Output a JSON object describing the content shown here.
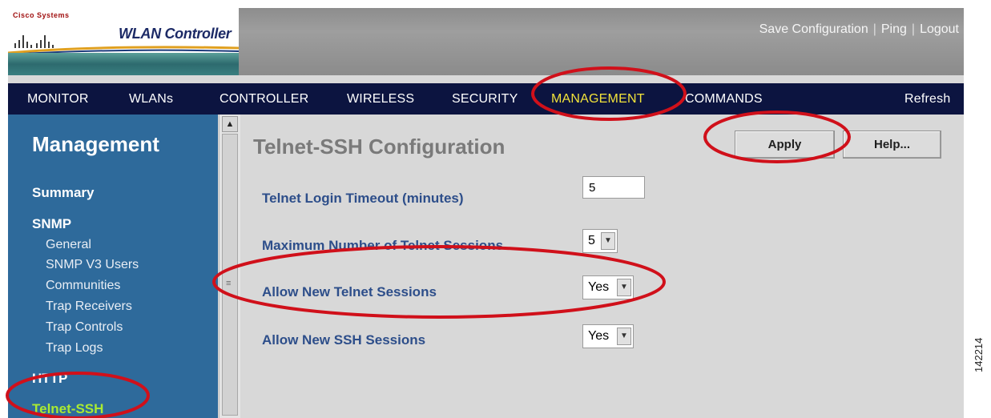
{
  "header": {
    "brand": "Cisco Systems",
    "product": "WLAN Controller",
    "links": [
      "Save Configuration",
      "Ping",
      "Logout"
    ]
  },
  "nav": {
    "items": [
      "MONITOR",
      "WLANs",
      "CONTROLLER",
      "WIRELESS",
      "SECURITY",
      "MANAGEMENT",
      "COMMANDS"
    ],
    "active": "MANAGEMENT",
    "refresh": "Refresh"
  },
  "sidebar": {
    "heading": "Management",
    "summary": "Summary",
    "snmp": "SNMP",
    "snmp_items": [
      "General",
      "SNMP V3 Users",
      "Communities",
      "Trap Receivers",
      "Trap Controls",
      "Trap Logs"
    ],
    "http": "HTTP",
    "telnet_ssh": "Telnet-SSH"
  },
  "main": {
    "title": "Telnet-SSH Configuration",
    "apply_label": "Apply",
    "help_label": "Help...",
    "fields": [
      {
        "label": "Telnet Login Timeout (minutes)",
        "value": "5"
      },
      {
        "label": "Maximum Number of Telnet Sessions",
        "value": "5"
      },
      {
        "label": "Allow New Telnet Sessions",
        "value": "Yes"
      },
      {
        "label": "Allow New SSH Sessions",
        "value": "Yes"
      }
    ]
  },
  "figure_number": "142214",
  "colors": {
    "nav_bg": "#0c1440",
    "nav_active": "#f2e33a",
    "sidebar_bg": "#2e6a9b",
    "sidebar_active": "#a9ea32",
    "label": "#2d4e8a",
    "annotation": "#d0101a"
  }
}
